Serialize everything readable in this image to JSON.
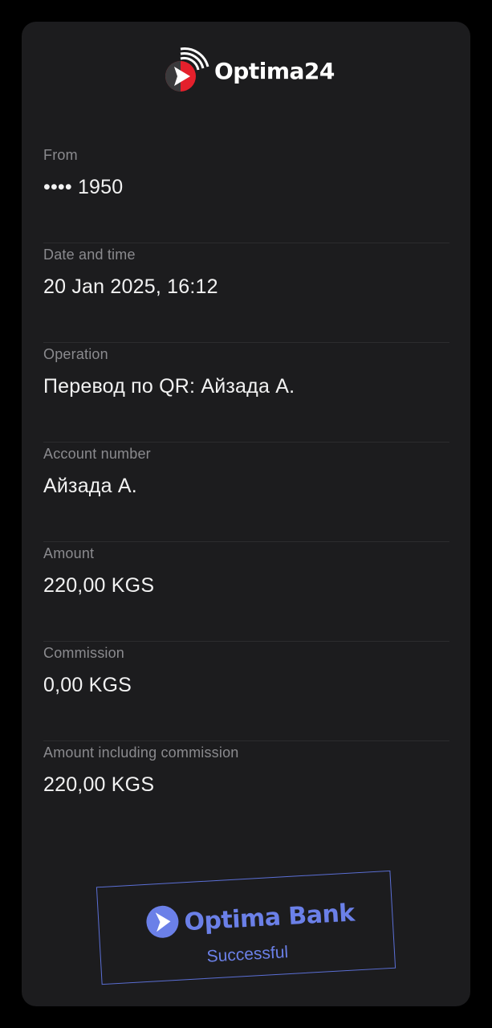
{
  "brand": {
    "logo_text": "Optima24"
  },
  "fields": [
    {
      "label": "From",
      "value": "•••• 1950"
    },
    {
      "label": "Date and time",
      "value": "20 Jan 2025, 16:12"
    },
    {
      "label": "Operation",
      "value": "Перевод по QR: Айзада А."
    },
    {
      "label": "Account number",
      "value": "Айзада А."
    },
    {
      "label": "Amount",
      "value": "220,00 KGS"
    },
    {
      "label": "Commission",
      "value": "0,00 KGS"
    },
    {
      "label": "Amount including commission",
      "value": "220,00 KGS"
    }
  ],
  "stamp": {
    "bank_name": "Optima Bank",
    "status": "Successful"
  },
  "colors": {
    "background": "#000000",
    "card": "#1c1c1e",
    "label": "#8a8a8e",
    "value": "#f2f2f2",
    "logo_red": "#e4202c",
    "stamp_blue": "#6b80e8"
  },
  "icons": {
    "logo": "optima24-logo-icon",
    "stamp_logo": "optima-bank-arrow-icon"
  }
}
